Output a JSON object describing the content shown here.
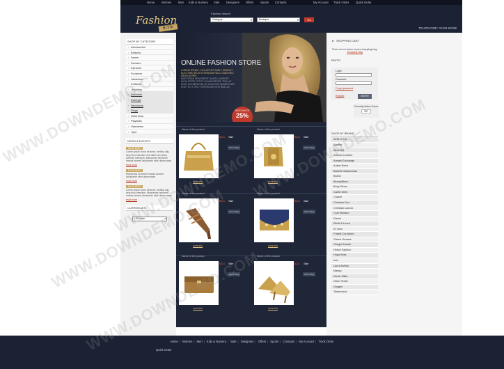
{
  "top_nav": [
    "Home",
    "Women",
    "Men",
    "Kids & Nursery",
    "Sale",
    "Designers",
    "Offers",
    "Sports",
    "Contacts",
    "My Account",
    "Track Order",
    "Quick Order"
  ],
  "logo": {
    "main": "Fashion",
    "sub": "StYle"
  },
  "search": {
    "label": "Fashion Search",
    "category_value": "Category",
    "boutique_value": "Boutique",
    "go_label": "Go"
  },
  "phone": "TELEPHONE: 01234 56789",
  "sidebar": {
    "category_title": "SHOP BY CATEGORY",
    "categories": [
      "Accessories",
      "Bottoms",
      "Denim",
      "Dresses",
      "Eyewear",
      "Footwear",
      "Handwear",
      "Knitwear",
      "Jewellery"
    ],
    "subcategories": [
      "Bracelets",
      "Earrings",
      "Necklaces",
      "Rings"
    ],
    "categories_after": [
      "Outerwear",
      "Playsuits",
      "Swimwear",
      "Tops"
    ],
    "news_title": "NEWS & EVENTS",
    "news": [
      {
        "date": "01.01.2010",
        "text": "Lorem ipsum dolor sit amet, sedsky alig sing eius interdum null diam nec dens. Aenean interdum. Maecenas hendrerit massa laoreet iaculipede ottot ulamcorper.",
        "more": "read more"
      },
      {
        "date": "01.01.2010",
        "text": "Maecenas hendrerit massa laoreet iaculipede ottot ulamcorper.",
        "more": "read more"
      },
      {
        "date": "01.01.2010",
        "text": "Lorem ipsum dolor sit amet, sedsky alig sing eius interdum. Maecenas hendrerit massa laoreet iaculipede ottot ulamcorper.",
        "more": "read more"
      }
    ],
    "currencies_title": "CURRENCIES",
    "currency_value": "US Dollar"
  },
  "banner": {
    "title": "ONLINE FASHION STORE",
    "subtitle": "LOREM IPSUM - DOLOR SIT AMET, SEDSKY ALIG SING EIUS INTERDUM NULL DIAM NEC DENS ADIPIS",
    "text": "MAECENAS HENDRERIT MASSA LAOREET IACULIPEDE OTTOT ULAMCORPER, TELLUS EROT ELEMENTUM, AT VOLUTPAT MAURIS NEC EGET ELIT. VELIT INTERDUM VESTIBULUM",
    "discount_label": "DISCOUNTS",
    "discount_value": "25%"
  },
  "products": [
    {
      "name": "Name of the product",
      "price": "$221",
      "sale": "Sale",
      "bag": "Add to Bag",
      "detail": "more info"
    },
    {
      "name": "Name of the product",
      "price": "$221",
      "sale": "Sale",
      "bag": "Add to Bag",
      "detail": "more info"
    },
    {
      "name": "Name of the product",
      "price": "$221",
      "sale": "Sale",
      "bag": "Add to Bag",
      "detail": "more info"
    },
    {
      "name": "Name of the product",
      "price": "$221",
      "sale": "Sale",
      "bag": "Add to Bag",
      "detail": "more info"
    },
    {
      "name": "Name of the product",
      "price": "$221",
      "sale": "Sale",
      "bag": "Add to Bag",
      "detail": "more info"
    },
    {
      "name": "Name of the product",
      "price": "$221",
      "sale": "Sale",
      "bag": "Add to Bag",
      "detail": "more info"
    }
  ],
  "cart": {
    "title": "SHOPPING CART",
    "empty": "There are no items in your shopping bag.",
    "link": "Shopping Bag"
  },
  "entry": {
    "title": "ENTRY",
    "login_label": "Login",
    "password_label": "Password",
    "forgot": "Forgot password",
    "register": "Register",
    "enter": "ENTER"
  },
  "active_users": {
    "label": "Currently Active Users:",
    "count": "287"
  },
  "brands": {
    "title": "SHOP BY BRAND",
    "items": [
      "Aeffe S.P.A",
      "Agatha",
      "Alma Sol",
      "Antonio Couture",
      "Armani Exchange",
      "Austin Reed",
      "Babette Wasserman",
      "BCBG",
      "BeautyBlanc",
      "Body Glove",
      "Calvin Klein",
      "Chanel",
      "Christian Dior",
      "Christian Lacroix",
      "Club Monaco",
      "Diesel",
      "Elliott & Lucca",
      "Et Vous",
      "Fratelli Corneliani",
      "Gianni Versace",
      "Giorgio Armani",
      "Hirsch Fashion",
      "Hugo Boss",
      "Inot",
      "Laura Ashley",
      "Mango",
      "Nicole Miller",
      "Oliver Smith",
      "Oxygen",
      "Timberland"
    ]
  },
  "footer": {
    "links": [
      "Home",
      "Women",
      "Men",
      "Kids & Nursery",
      "Sale",
      "Designers",
      "Offers",
      "Sports",
      "Contacts",
      "My Account",
      "Track Order"
    ],
    "second_row": "Quick Order"
  },
  "watermark": "WWW.DOWNDEMO.COM"
}
